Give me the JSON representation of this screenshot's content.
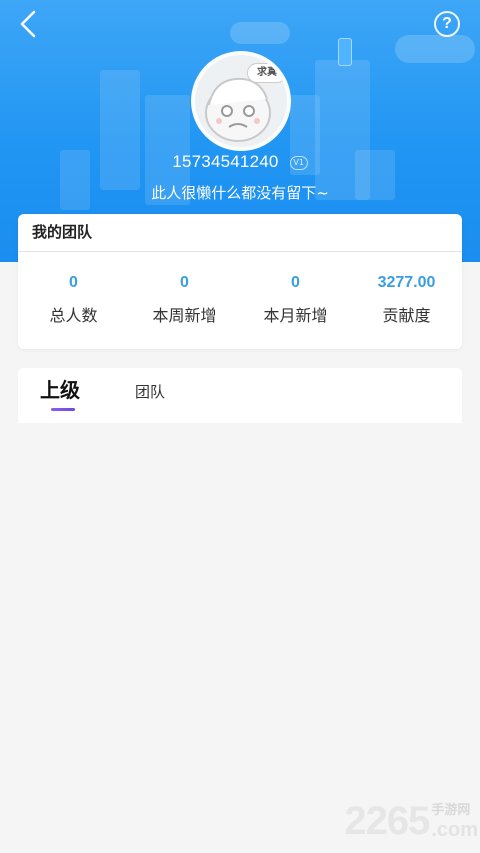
{
  "header": {
    "back_icon": "chevron-left-icon",
    "help_icon": "question-circle-icon",
    "help_glyph": "?"
  },
  "profile": {
    "avatar_bubble_text": "求真",
    "phone": "15734541240",
    "vip_badge": "V1",
    "motto": "此人很懒什么都没有留下~"
  },
  "team": {
    "title": "我的团队",
    "stats": [
      {
        "value": "0",
        "label": "总人数"
      },
      {
        "value": "0",
        "label": "本周新增"
      },
      {
        "value": "0",
        "label": "本月新增"
      },
      {
        "value": "3277.00",
        "label": "贡献度"
      }
    ]
  },
  "tabs": {
    "active": "上级",
    "other": "团队"
  },
  "watermark": {
    "number": "2265",
    "cn": "手游网",
    "domain": ".com"
  },
  "colors": {
    "hero_blue": "#2196f3",
    "stat_value_blue": "#3a9ee0",
    "tab_accent": "#7b4fe8",
    "page_bg": "#f5f5f5"
  }
}
